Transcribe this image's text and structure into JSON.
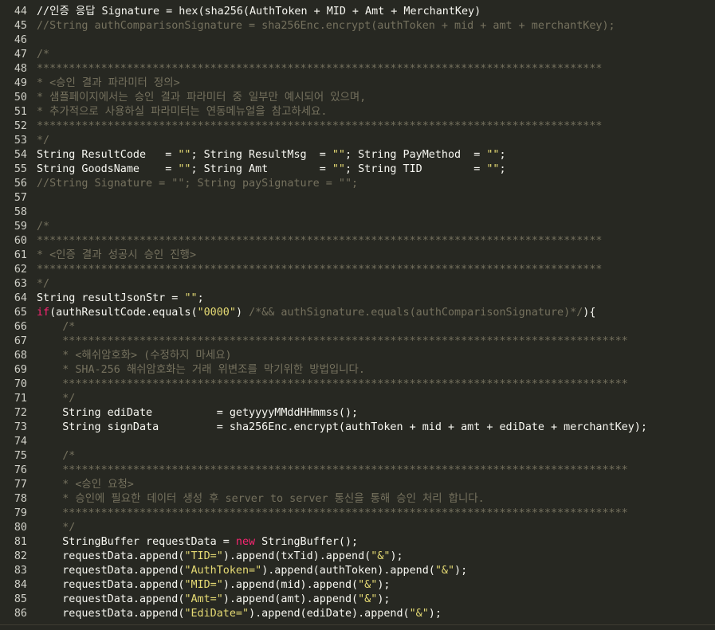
{
  "editor": {
    "background": "#272822",
    "colors": {
      "comment": "#75715e",
      "string": "#e6db74",
      "keyword": "#f92672",
      "text": "#f8f8f2"
    },
    "lines": [
      {
        "n": "44",
        "tokens": [
          {
            "t": "//인증 응답 Signature = hex(sha256(AuthToken + MID + Amt + MerchantKey)",
            "c": "text"
          }
        ]
      },
      {
        "n": "45",
        "tokens": [
          {
            "t": "//String authComparisonSignature = sha256Enc.encrypt(authToken + mid + amt + merchantKey);",
            "c": "comment"
          }
        ]
      },
      {
        "n": "46",
        "tokens": []
      },
      {
        "n": "47",
        "tokens": [
          {
            "t": "/*",
            "c": "comment"
          }
        ]
      },
      {
        "n": "48",
        "tokens": [
          {
            "t": "****************************************************************************************",
            "c": "comment"
          }
        ]
      },
      {
        "n": "49",
        "tokens": [
          {
            "t": "* <승인 결과 파라미터 정의>",
            "c": "comment"
          }
        ]
      },
      {
        "n": "50",
        "tokens": [
          {
            "t": "* 샘플페이지에서는 승인 결과 파라미터 중 일부만 예시되어 있으며,",
            "c": "comment"
          }
        ]
      },
      {
        "n": "51",
        "tokens": [
          {
            "t": "* 추가적으로 사용하실 파라미터는 연동메뉴얼을 참고하세요.",
            "c": "comment"
          }
        ]
      },
      {
        "n": "52",
        "tokens": [
          {
            "t": "****************************************************************************************",
            "c": "comment"
          }
        ]
      },
      {
        "n": "53",
        "tokens": [
          {
            "t": "*/",
            "c": "comment"
          }
        ]
      },
      {
        "n": "54",
        "tokens": [
          {
            "t": "String ResultCode   = ",
            "c": "text"
          },
          {
            "t": "\"\"",
            "c": "string"
          },
          {
            "t": "; String ResultMsg  = ",
            "c": "text"
          },
          {
            "t": "\"\"",
            "c": "string"
          },
          {
            "t": "; String PayMethod  = ",
            "c": "text"
          },
          {
            "t": "\"\"",
            "c": "string"
          },
          {
            "t": ";",
            "c": "text"
          }
        ]
      },
      {
        "n": "55",
        "tokens": [
          {
            "t": "String GoodsName    = ",
            "c": "text"
          },
          {
            "t": "\"\"",
            "c": "string"
          },
          {
            "t": "; String Amt        = ",
            "c": "text"
          },
          {
            "t": "\"\"",
            "c": "string"
          },
          {
            "t": "; String TID        = ",
            "c": "text"
          },
          {
            "t": "\"\"",
            "c": "string"
          },
          {
            "t": ";",
            "c": "text"
          }
        ]
      },
      {
        "n": "56",
        "tokens": [
          {
            "t": "//String Signature = \"\"; String paySignature = \"\";",
            "c": "comment"
          }
        ]
      },
      {
        "n": "57",
        "tokens": []
      },
      {
        "n": "58",
        "tokens": []
      },
      {
        "n": "59",
        "tokens": [
          {
            "t": "/*",
            "c": "comment"
          }
        ]
      },
      {
        "n": "60",
        "tokens": [
          {
            "t": "****************************************************************************************",
            "c": "comment"
          }
        ]
      },
      {
        "n": "61",
        "tokens": [
          {
            "t": "* <인증 결과 성공시 승인 진행>",
            "c": "comment"
          }
        ]
      },
      {
        "n": "62",
        "tokens": [
          {
            "t": "****************************************************************************************",
            "c": "comment"
          }
        ]
      },
      {
        "n": "63",
        "tokens": [
          {
            "t": "*/",
            "c": "comment"
          }
        ]
      },
      {
        "n": "64",
        "tokens": [
          {
            "t": "String resultJsonStr = ",
            "c": "text"
          },
          {
            "t": "\"\"",
            "c": "string"
          },
          {
            "t": ";",
            "c": "text"
          }
        ]
      },
      {
        "n": "65",
        "tokens": [
          {
            "t": "if",
            "c": "keyword"
          },
          {
            "t": "(authResultCode.equals(",
            "c": "text"
          },
          {
            "t": "\"0000\"",
            "c": "string"
          },
          {
            "t": ") ",
            "c": "text"
          },
          {
            "t": "/*&& authSignature.equals(authComparisonSignature)*/",
            "c": "comment"
          },
          {
            "t": "){",
            "c": "text"
          }
        ]
      },
      {
        "n": "66",
        "tokens": [
          {
            "t": "    /*",
            "c": "comment"
          }
        ]
      },
      {
        "n": "67",
        "tokens": [
          {
            "t": "    ****************************************************************************************",
            "c": "comment"
          }
        ]
      },
      {
        "n": "68",
        "tokens": [
          {
            "t": "    * <해쉬암호화> (수정하지 마세요)",
            "c": "comment"
          }
        ]
      },
      {
        "n": "69",
        "tokens": [
          {
            "t": "    * SHA-256 해쉬암호화는 거래 위변조를 막기위한 방법입니다.",
            "c": "comment"
          }
        ]
      },
      {
        "n": "70",
        "tokens": [
          {
            "t": "    ****************************************************************************************",
            "c": "comment"
          }
        ]
      },
      {
        "n": "71",
        "tokens": [
          {
            "t": "    */",
            "c": "comment"
          }
        ]
      },
      {
        "n": "72",
        "tokens": [
          {
            "t": "    String ediDate          = getyyyyMMddHHmmss();",
            "c": "text"
          }
        ]
      },
      {
        "n": "73",
        "tokens": [
          {
            "t": "    String signData         = sha256Enc.encrypt(authToken + mid + amt + ediDate + merchantKey);",
            "c": "text"
          }
        ]
      },
      {
        "n": "74",
        "tokens": []
      },
      {
        "n": "75",
        "tokens": [
          {
            "t": "    /*",
            "c": "comment"
          }
        ]
      },
      {
        "n": "76",
        "tokens": [
          {
            "t": "    ****************************************************************************************",
            "c": "comment"
          }
        ]
      },
      {
        "n": "77",
        "tokens": [
          {
            "t": "    * <승인 요청>",
            "c": "comment"
          }
        ]
      },
      {
        "n": "78",
        "tokens": [
          {
            "t": "    * 승인에 필요한 데이터 생성 후 server to server 통신을 통해 승인 처리 합니다.",
            "c": "comment"
          }
        ]
      },
      {
        "n": "79",
        "tokens": [
          {
            "t": "    ****************************************************************************************",
            "c": "comment"
          }
        ]
      },
      {
        "n": "80",
        "tokens": [
          {
            "t": "    */",
            "c": "comment"
          }
        ]
      },
      {
        "n": "81",
        "tokens": [
          {
            "t": "    StringBuffer requestData = ",
            "c": "text"
          },
          {
            "t": "new",
            "c": "keyword"
          },
          {
            "t": " StringBuffer();",
            "c": "text"
          }
        ]
      },
      {
        "n": "82",
        "tokens": [
          {
            "t": "    requestData.append(",
            "c": "text"
          },
          {
            "t": "\"TID=\"",
            "c": "string"
          },
          {
            "t": ").append(txTid).append(",
            "c": "text"
          },
          {
            "t": "\"&\"",
            "c": "string"
          },
          {
            "t": ");",
            "c": "text"
          }
        ]
      },
      {
        "n": "83",
        "tokens": [
          {
            "t": "    requestData.append(",
            "c": "text"
          },
          {
            "t": "\"AuthToken=\"",
            "c": "string"
          },
          {
            "t": ").append(authToken).append(",
            "c": "text"
          },
          {
            "t": "\"&\"",
            "c": "string"
          },
          {
            "t": ");",
            "c": "text"
          }
        ]
      },
      {
        "n": "84",
        "tokens": [
          {
            "t": "    requestData.append(",
            "c": "text"
          },
          {
            "t": "\"MID=\"",
            "c": "string"
          },
          {
            "t": ").append(mid).append(",
            "c": "text"
          },
          {
            "t": "\"&\"",
            "c": "string"
          },
          {
            "t": ");",
            "c": "text"
          }
        ]
      },
      {
        "n": "85",
        "tokens": [
          {
            "t": "    requestData.append(",
            "c": "text"
          },
          {
            "t": "\"Amt=\"",
            "c": "string"
          },
          {
            "t": ").append(amt).append(",
            "c": "text"
          },
          {
            "t": "\"&\"",
            "c": "string"
          },
          {
            "t": ");",
            "c": "text"
          }
        ]
      },
      {
        "n": "86",
        "tokens": [
          {
            "t": "    requestData.append(",
            "c": "text"
          },
          {
            "t": "\"EdiDate=\"",
            "c": "string"
          },
          {
            "t": ").append(ediDate).append(",
            "c": "text"
          },
          {
            "t": "\"&\"",
            "c": "string"
          },
          {
            "t": ");",
            "c": "text"
          }
        ]
      }
    ]
  }
}
